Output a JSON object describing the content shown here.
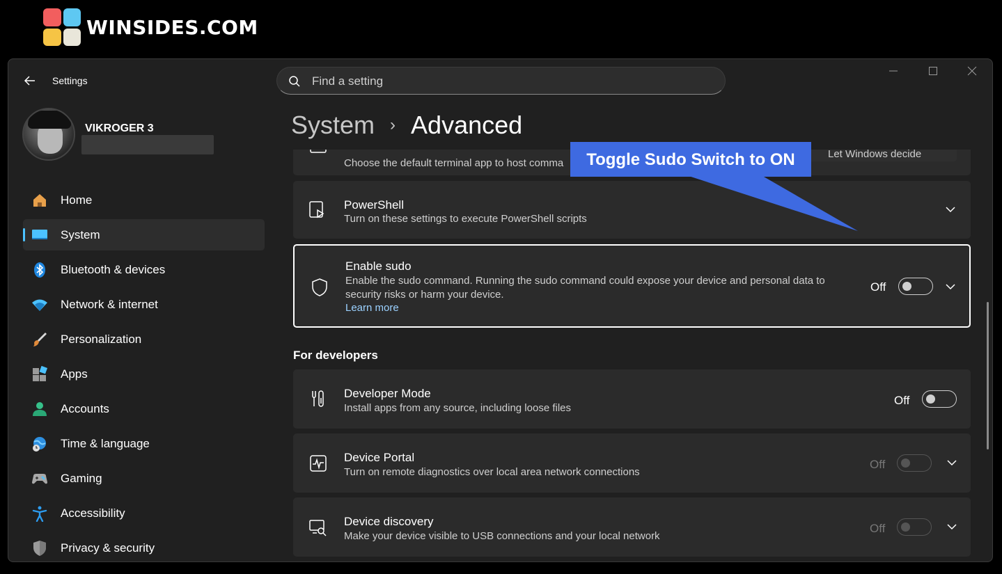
{
  "watermark": {
    "text": "WINSIDES.COM"
  },
  "app": {
    "title": "Settings"
  },
  "window_controls": {
    "minimize": "—",
    "maximize": "☐",
    "close": "✕"
  },
  "search": {
    "placeholder": "Find a setting"
  },
  "profile": {
    "name": "VIKROGER 3"
  },
  "nav": {
    "items": [
      {
        "label": "Home",
        "icon": "home-icon"
      },
      {
        "label": "System",
        "icon": "system-icon",
        "active": true
      },
      {
        "label": "Bluetooth & devices",
        "icon": "bluetooth-icon"
      },
      {
        "label": "Network & internet",
        "icon": "wifi-icon"
      },
      {
        "label": "Personalization",
        "icon": "brush-icon"
      },
      {
        "label": "Apps",
        "icon": "apps-icon"
      },
      {
        "label": "Accounts",
        "icon": "accounts-icon"
      },
      {
        "label": "Time & language",
        "icon": "globe-clock-icon"
      },
      {
        "label": "Gaming",
        "icon": "gamepad-icon"
      },
      {
        "label": "Accessibility",
        "icon": "accessibility-icon"
      },
      {
        "label": "Privacy & security",
        "icon": "shield-icon"
      }
    ]
  },
  "breadcrumb": {
    "parent": "System",
    "separator": "›",
    "current": "Advanced"
  },
  "cards": {
    "terminal": {
      "desc": "Choose the default terminal app to host comma",
      "dropdown_fragment": "Let Windows decide"
    },
    "powershell": {
      "title": "PowerShell",
      "desc": "Turn on these settings to execute PowerShell scripts"
    },
    "sudo": {
      "title": "Enable sudo",
      "desc_line1": "Enable the sudo command. Running the sudo command could expose your device and personal data to",
      "desc_line2": "security risks or harm your device.",
      "link": "Learn more",
      "state": "Off"
    },
    "section_developers": "For developers",
    "developer_mode": {
      "title": "Developer Mode",
      "desc": "Install apps from any source, including loose files",
      "state": "Off"
    },
    "device_portal": {
      "title": "Device Portal",
      "desc": "Turn on remote diagnostics over local area network connections",
      "state": "Off"
    },
    "device_discovery": {
      "title": "Device discovery",
      "desc": "Make your device visible to USB connections and your local network",
      "state": "Off"
    }
  },
  "annotation": {
    "text": "Toggle Sudo Switch to ON",
    "color": "#3e6ae1"
  },
  "colors": {
    "accent": "#4cc2ff",
    "card": "#2b2b2b",
    "window": "#202020",
    "link": "#9bd1ff"
  }
}
